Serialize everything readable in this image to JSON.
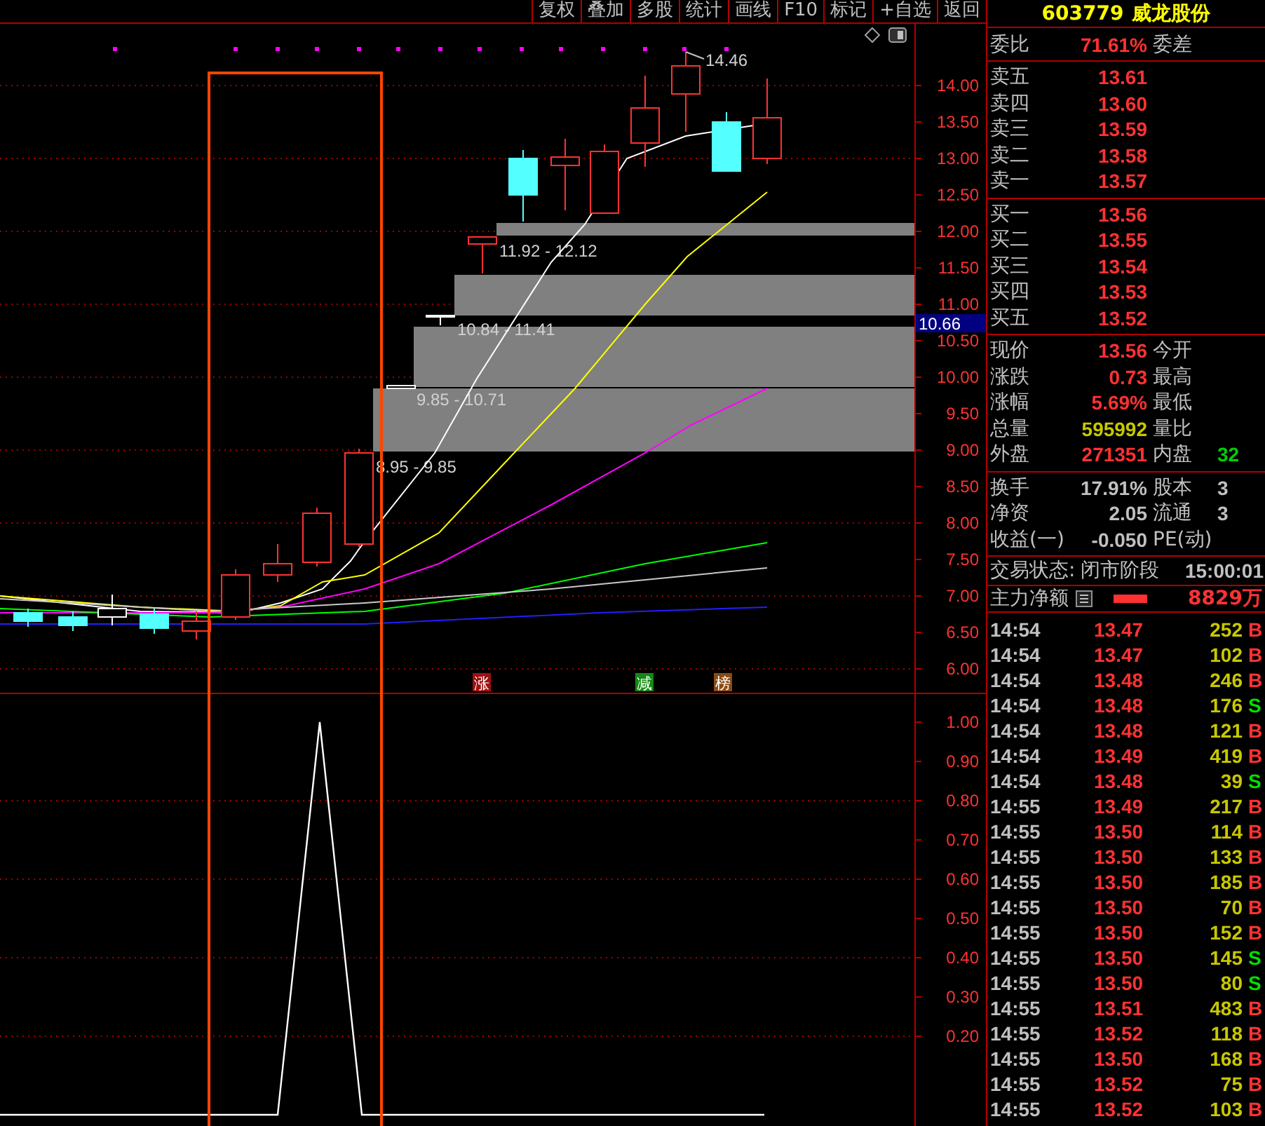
{
  "toolbar": {
    "buttons": [
      {
        "label": "复权"
      },
      {
        "label": "叠加"
      },
      {
        "label": "多股"
      },
      {
        "label": "统计"
      },
      {
        "label": "画线"
      },
      {
        "label": "F10"
      },
      {
        "label": "标记"
      },
      {
        "label": "+自选"
      },
      {
        "label": "返回"
      }
    ]
  },
  "price_chart": {
    "high_label": "14.46",
    "current_price_tag": "10.66",
    "y_axis_labels": [
      "14.00",
      "13.50",
      "13.00",
      "12.50",
      "12.00",
      "11.50",
      "11.00",
      "10.50",
      "10.00",
      "9.50",
      "9.00",
      "8.50",
      "8.00",
      "7.50",
      "7.00",
      "6.50",
      "6.00"
    ],
    "price_zones": [
      {
        "label": "11.92 - 12.12"
      },
      {
        "label": "10.84 - 11.41"
      },
      {
        "label": "9.85 - 10.71"
      },
      {
        "label": "8.95 - 9.85"
      }
    ],
    "event_tags": [
      {
        "label": "涨",
        "color": "#a01010"
      },
      {
        "label": "减",
        "color": "#138a13"
      },
      {
        "label": "榜",
        "color": "#8a4a12"
      }
    ]
  },
  "indicator_chart": {
    "y_axis_labels": [
      "1.00",
      "0.90",
      "0.80",
      "0.70",
      "0.60",
      "0.50",
      "0.40",
      "0.30",
      "0.20"
    ]
  },
  "quote_panel": {
    "code": "603779",
    "name": "威龙股份",
    "commission": {
      "label": "委比",
      "value": "71.61%",
      "label_2": "委差"
    },
    "asks": [
      {
        "label": "卖五",
        "price": "13.61"
      },
      {
        "label": "卖四",
        "price": "13.60"
      },
      {
        "label": "卖三",
        "price": "13.59"
      },
      {
        "label": "卖二",
        "price": "13.58"
      },
      {
        "label": "卖一",
        "price": "13.57"
      }
    ],
    "bids": [
      {
        "label": "买一",
        "price": "13.56"
      },
      {
        "label": "买二",
        "price": "13.55"
      },
      {
        "label": "买三",
        "price": "13.54"
      },
      {
        "label": "买四",
        "price": "13.53"
      },
      {
        "label": "买五",
        "price": "13.52"
      }
    ],
    "stats": [
      {
        "cells": [
          {
            "label": "现价",
            "value": "13.56",
            "color": "#ff3232"
          },
          {
            "label": "今开"
          }
        ]
      },
      {
        "cells": [
          {
            "label": "涨跌",
            "value": "0.73",
            "color": "#ff3232"
          },
          {
            "label": "最高"
          }
        ]
      },
      {
        "cells": [
          {
            "label": "涨幅",
            "value": "5.69%",
            "color": "#ff3232"
          },
          {
            "label": "最低"
          }
        ]
      },
      {
        "cells": [
          {
            "label": "总量",
            "value": "595992",
            "color": "#c8c800"
          },
          {
            "label": "量比"
          }
        ]
      },
      {
        "cells": [
          {
            "label": "外盘",
            "value": "271351",
            "color": "#ff3232"
          },
          {
            "label": "内盘",
            "value": "32",
            "color": "#00d000"
          }
        ]
      }
    ],
    "fundamentals": [
      {
        "cells": [
          {
            "label": "换手",
            "value": "17.91%",
            "color": "#c0c0c0"
          },
          {
            "label": "股本",
            "value": "3",
            "color": "#c0c0c0"
          }
        ]
      },
      {
        "cells": [
          {
            "label": "净资",
            "value": "2.05",
            "color": "#c0c0c0"
          },
          {
            "label": "流通",
            "value": "3",
            "color": "#c0c0c0"
          }
        ]
      },
      {
        "cells": [
          {
            "label": "收益(一)",
            "value": "-0.050",
            "color": "#c0c0c0"
          },
          {
            "label": "PE(动)"
          }
        ]
      }
    ],
    "trade_status": {
      "label": "交易状态:",
      "value": "闭市阶段",
      "time": "15:00:01"
    },
    "main_net": {
      "label": "主力净额",
      "value": "8829万"
    },
    "trades": [
      {
        "time": "14:54",
        "price": "13.47",
        "volume": "252",
        "side": "B",
        "kind": "buy"
      },
      {
        "time": "14:54",
        "price": "13.47",
        "volume": "102",
        "side": "B",
        "kind": "buy"
      },
      {
        "time": "14:54",
        "price": "13.48",
        "volume": "246",
        "side": "B",
        "kind": "buy"
      },
      {
        "time": "14:54",
        "price": "13.48",
        "volume": "176",
        "side": "S",
        "kind": "sell"
      },
      {
        "time": "14:54",
        "price": "13.48",
        "volume": "121",
        "side": "B",
        "kind": "buy"
      },
      {
        "time": "14:54",
        "price": "13.49",
        "volume": "419",
        "side": "B",
        "kind": "buy"
      },
      {
        "time": "14:54",
        "price": "13.48",
        "volume": "39",
        "side": "S",
        "kind": "sell"
      },
      {
        "time": "14:55",
        "price": "13.49",
        "volume": "217",
        "side": "B",
        "kind": "buy"
      },
      {
        "time": "14:55",
        "price": "13.50",
        "volume": "114",
        "side": "B",
        "kind": "buy"
      },
      {
        "time": "14:55",
        "price": "13.50",
        "volume": "133",
        "side": "B",
        "kind": "buy"
      },
      {
        "time": "14:55",
        "price": "13.50",
        "volume": "185",
        "side": "B",
        "kind": "buy"
      },
      {
        "time": "14:55",
        "price": "13.50",
        "volume": "70",
        "side": "B",
        "kind": "buy"
      },
      {
        "time": "14:55",
        "price": "13.50",
        "volume": "152",
        "side": "B",
        "kind": "buy"
      },
      {
        "time": "14:55",
        "price": "13.50",
        "volume": "145",
        "side": "S",
        "kind": "sell"
      },
      {
        "time": "14:55",
        "price": "13.50",
        "volume": "80",
        "side": "S",
        "kind": "sell"
      },
      {
        "time": "14:55",
        "price": "13.51",
        "volume": "483",
        "side": "B",
        "kind": "buy"
      },
      {
        "time": "14:55",
        "price": "13.52",
        "volume": "118",
        "side": "B",
        "kind": "buy"
      },
      {
        "time": "14:55",
        "price": "13.50",
        "volume": "168",
        "side": "B",
        "kind": "buy"
      },
      {
        "time": "14:55",
        "price": "13.52",
        "volume": "75",
        "side": "B",
        "kind": "buy"
      },
      {
        "time": "14:55",
        "price": "13.52",
        "volume": "103",
        "side": "B",
        "kind": "buy"
      }
    ]
  }
}
